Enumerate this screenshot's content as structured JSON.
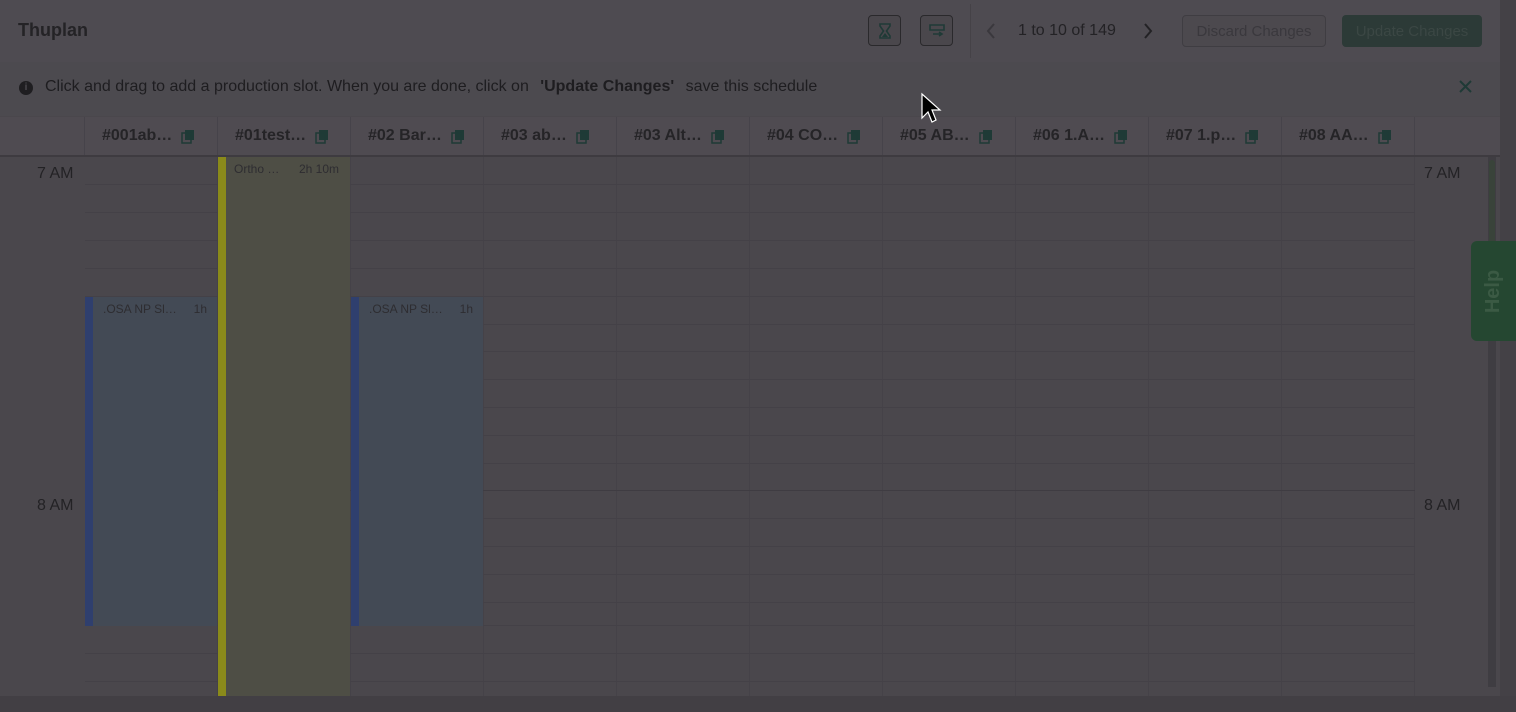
{
  "app": {
    "title": "Thuplan"
  },
  "toolbar": {
    "pager": {
      "text": "1 to 10 of 149"
    },
    "discard_label": "Discard Changes",
    "update_label": "Update Changes"
  },
  "banner": {
    "text_before": "Click and drag to add a production slot. When you are done, click on",
    "text_bold": "'Update Changes'",
    "text_after": "save this schedule"
  },
  "columns": [
    {
      "label": "#001ab…"
    },
    {
      "label": "#01test…"
    },
    {
      "label": "#02 Bar…"
    },
    {
      "label": "#03 ab…"
    },
    {
      "label": "#03 Alt…"
    },
    {
      "label": "#04 CO…"
    },
    {
      "label": "#05 AB…"
    },
    {
      "label": "#06 1.A…"
    },
    {
      "label": "#07 1.p…"
    },
    {
      "label": "#08 AA…"
    }
  ],
  "times": {
    "t7": "7 AM",
    "t8": "8 AM"
  },
  "events": [
    {
      "name": ".OSA NP Sl…",
      "duration": "1h"
    },
    {
      "name": "Ortho …",
      "duration": "2h 10m"
    },
    {
      "name": ".OSA NP Sl…",
      "duration": "1h"
    }
  ],
  "help": {
    "label": "Help"
  },
  "colors": {
    "event_blue_bar": "#2f3f6e",
    "event_blue_fill": "#434a55",
    "event_yellow_bar": "#8a8a1a",
    "event_yellow_fill": "#4e4e45",
    "accent_green": "#254731"
  }
}
